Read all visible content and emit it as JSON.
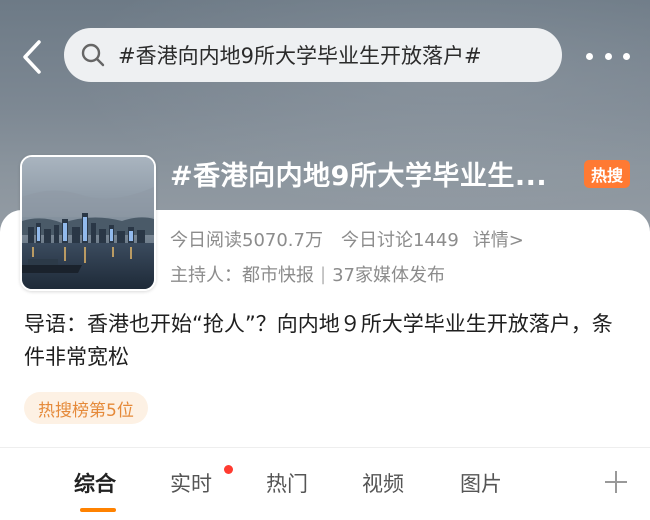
{
  "header": {
    "search_text": "#香港向内地9所大学毕业生开放落户#"
  },
  "topic": {
    "title": "#香港向内地9所大学毕业生...",
    "hot_label": "热搜",
    "reads": "今日阅读5070.7万",
    "discussions": "今日讨论1449",
    "details_link": "详情>",
    "host": "主持人：都市快报",
    "media": "37家媒体发布"
  },
  "intro": {
    "text": "导语：香港也开始“抢人”？向内地９所大学毕业生开放落户，条件非常宽松"
  },
  "rank_badge": "热搜榜第5位",
  "tabs": [
    {
      "label": "综合"
    },
    {
      "label": "实时"
    },
    {
      "label": "热门"
    },
    {
      "label": "视频"
    },
    {
      "label": "图片"
    }
  ],
  "colors": {
    "accent": "#ff8200",
    "hot_badge": "#ff7a33",
    "notification_dot": "#ff3b30"
  },
  "icons": [
    "back-arrow-icon",
    "search-icon",
    "more-dots-icon",
    "plus-icon"
  ]
}
